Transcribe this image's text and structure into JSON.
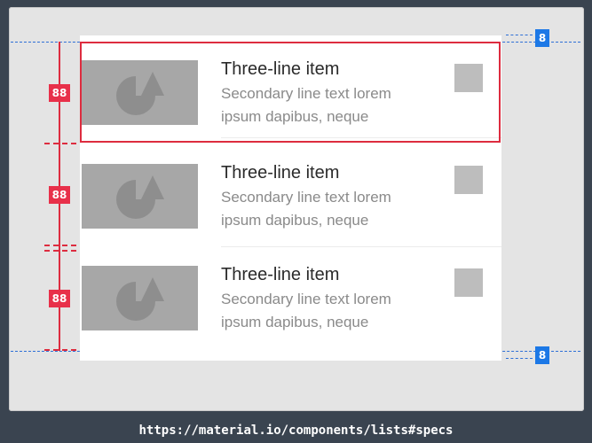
{
  "list": {
    "items": [
      {
        "title": "Three-line item",
        "line1": "Secondary line text lorem",
        "line2": "ipsum dapibus, neque",
        "thumbnail": "shapes-placeholder-icon",
        "trailing": "checkbox"
      },
      {
        "title": "Three-line item",
        "line1": "Secondary line text lorem",
        "line2": "ipsum dapibus, neque",
        "thumbnail": "shapes-placeholder-icon",
        "trailing": "checkbox"
      },
      {
        "title": "Three-line item",
        "line1": "Secondary line text lorem",
        "line2": "ipsum dapibus, neque",
        "thumbnail": "shapes-placeholder-icon",
        "trailing": "checkbox"
      }
    ]
  },
  "annotations": {
    "item_height": "88",
    "padding_top": "8",
    "padding_bottom": "8"
  },
  "caption": {
    "url": "https://material.io/components/lists#specs"
  },
  "colors": {
    "measure_red": "#e8304a",
    "measure_blue": "#1c78e6",
    "placeholder_gray": "#a7a7a7"
  }
}
